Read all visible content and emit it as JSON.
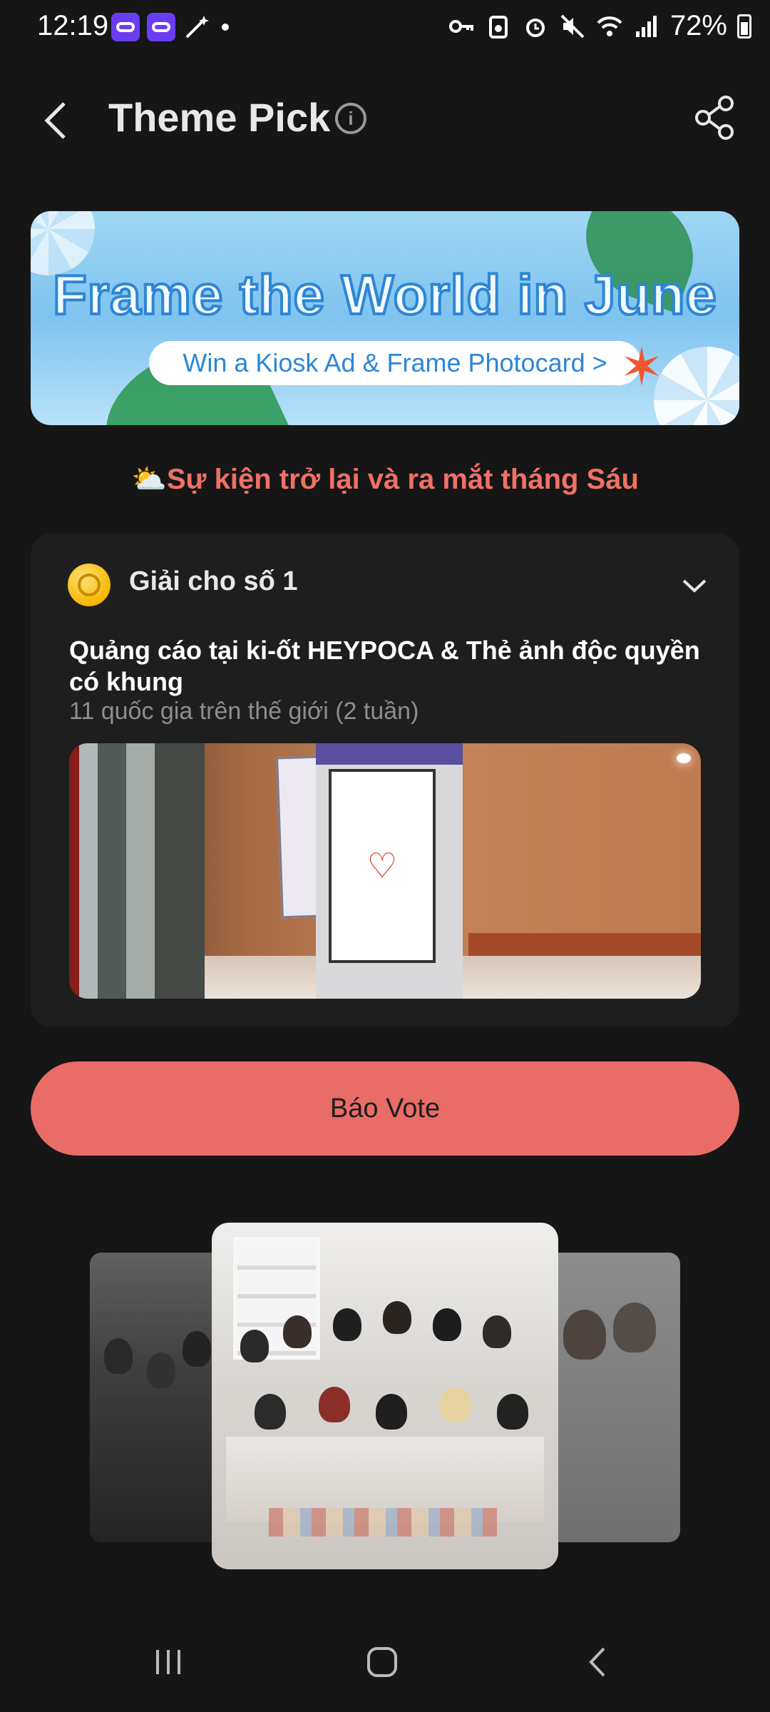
{
  "status_bar": {
    "time": "12:19",
    "battery_percent": "72%"
  },
  "header": {
    "title": "Theme Pick"
  },
  "banner": {
    "headline": "Frame the World in June",
    "cta": "Win a Kiosk Ad & Frame Photocard >"
  },
  "event_line": "⛅Sự kiện trở lại và ra mắt tháng Sáu",
  "prize": {
    "heading": "Giải cho số 1",
    "title": "Quảng cáo tại ki-ốt HEYPOCA & Thẻ ảnh độc quyền có khung",
    "subtitle": "11 quốc gia trên thế giới (2 tuần)"
  },
  "vote_button": "Báo Vote",
  "colors": {
    "background": "#161616",
    "accent": "#ea6c66",
    "event_text": "#f07066"
  }
}
